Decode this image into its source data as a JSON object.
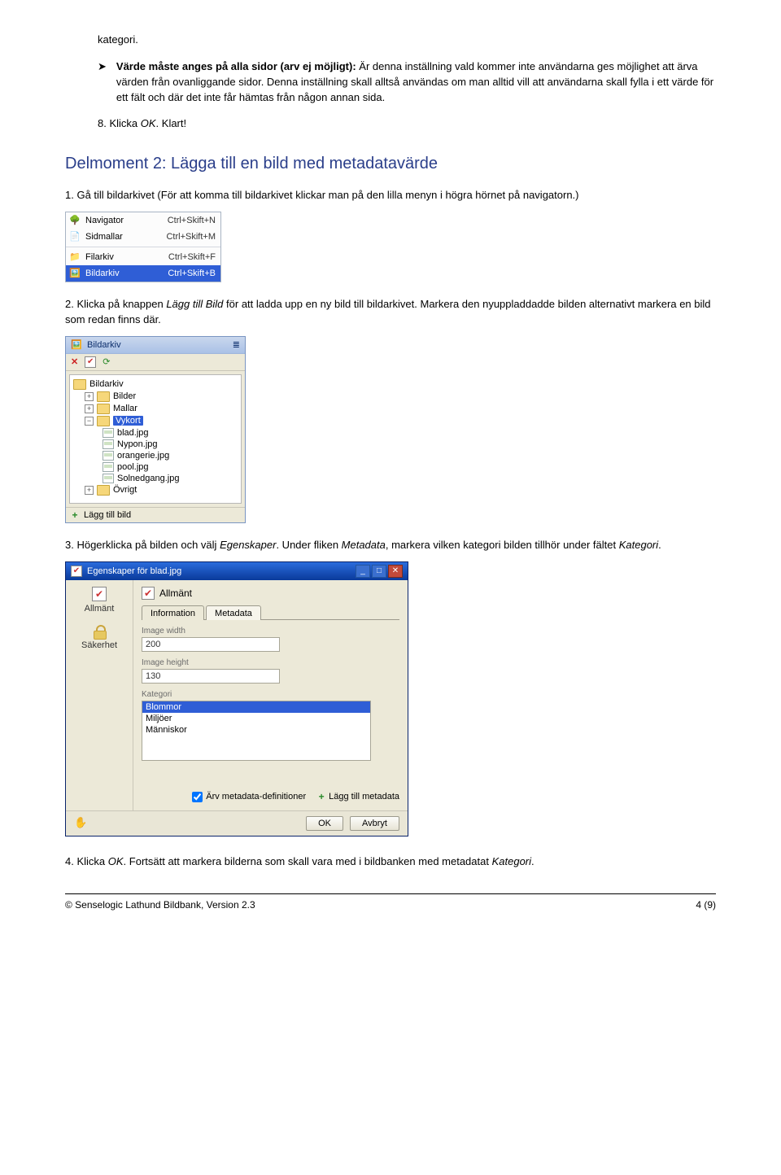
{
  "intro": {
    "kategori": "kategori.",
    "bullet_lead": "Värde måste anges på alla sidor (arv ej möjligt):",
    "bullet_rest": " Är denna inställning vald kommer inte användarna ges möjlighet att ärva värden från ovanliggande sidor. Denna inställning skall alltså användas om man alltid vill att användarna skall fylla i ett värde för ett fält och där det inte får hämtas från någon annan sida.",
    "step8": "8. Klicka ",
    "ok": "OK",
    "klart": ". Klart!"
  },
  "heading": "Delmoment 2: Lägga till en bild med metadatavärde",
  "steps": {
    "s1": "1. Gå till bildarkivet (För att komma till bildarkivet klickar man på den lilla menyn i högra hörnet på navigatorn.)",
    "s2a": "2. Klicka på knappen ",
    "s2b": "Lägg till Bild",
    "s2c": " för att ladda upp en ny bild till bildarkivet. Markera den nyuppladdadde bilden alternativt markera en bild som redan finns där.",
    "s3a": "3. Högerklicka på bilden och välj ",
    "s3b": "Egenskaper",
    "s3c": ". Under fliken ",
    "s3d": "Metadata",
    "s3e": ", markera vilken kategori bilden tillhör under fältet ",
    "s3f": "Kategori",
    "s3g": ".",
    "s4a": "4. Klicka ",
    "s4b": "OK",
    "s4c": ". Fortsätt att markera bilderna som skall vara med i bildbanken med metadatat ",
    "s4d": "Kategori",
    "s4e": "."
  },
  "menu": {
    "navigator": "Navigator",
    "navigator_sc": "Ctrl+Skift+N",
    "sidmallar": "Sidmallar",
    "sidmallar_sc": "Ctrl+Skift+M",
    "filarkiv": "Filarkiv",
    "filarkiv_sc": "Ctrl+Skift+F",
    "bildarkiv": "Bildarkiv",
    "bildarkiv_sc": "Ctrl+Skift+B"
  },
  "panel": {
    "title": "Bildarkiv",
    "root": "Bildarkiv",
    "bilder": "Bilder",
    "mallar": "Mallar",
    "vykort": "Vykort",
    "files": [
      "blad.jpg",
      "Nypon.jpg",
      "orangerie.jpg",
      "pool.jpg",
      "Solnedgang.jpg"
    ],
    "ovrigt": "Övrigt",
    "add": "Lägg till bild"
  },
  "dialog": {
    "title": "Egenskaper för blad.jpg",
    "allmant": "Allmänt",
    "sakerhet": "Säkerhet",
    "tab_info": "Information",
    "tab_meta": "Metadata",
    "iw_label": "Image width",
    "iw_value": "200",
    "ih_label": "Image height",
    "ih_value": "130",
    "kat_label": "Kategori",
    "opts": [
      "Blommor",
      "Miljöer",
      "Människor"
    ],
    "inherit": "Ärv metadata-definitioner",
    "addmeta": "Lägg till metadata",
    "ok": "OK",
    "cancel": "Avbryt"
  },
  "footer": {
    "left": "© Senselogic Lathund Bildbank, Version 2.3",
    "right": "4 (9)"
  }
}
